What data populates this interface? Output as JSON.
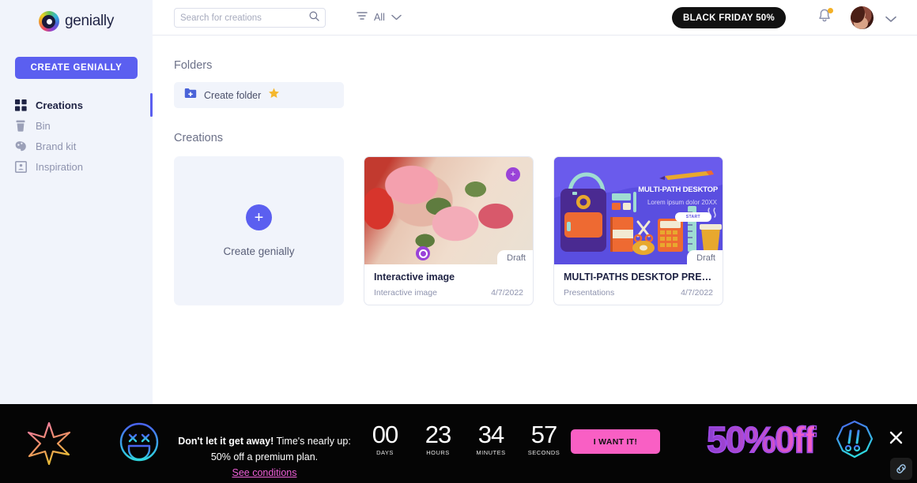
{
  "brand": {
    "name": "genially",
    "accent": "#5b5ff0"
  },
  "sidebar": {
    "create_button": "CREATE GENIALLY",
    "items": [
      {
        "label": "Creations",
        "icon": "grid-icon"
      },
      {
        "label": "Bin",
        "icon": "trash-icon"
      },
      {
        "label": "Brand kit",
        "icon": "paint-icon"
      },
      {
        "label": "Inspiration",
        "icon": "frame-icon"
      }
    ]
  },
  "topbar": {
    "search_placeholder": "Search for creations",
    "search_value": "",
    "filter_label": "All",
    "promo_button": "BLACK FRIDAY 50%"
  },
  "main": {
    "folders_heading": "Folders",
    "create_folder_label": "Create folder",
    "creations_heading": "Creations",
    "create_card_label": "Create genially",
    "cards": [
      {
        "title": "Interactive image",
        "type": "Interactive image",
        "date": "4/7/2022",
        "status": "Draft"
      },
      {
        "title": "MULTI-PATHS DESKTOP PRESENT…",
        "type": "Presentations",
        "date": "4/7/2022",
        "status": "Draft",
        "thumb_title": "MULTI-PATH DESKTOP",
        "thumb_subtitle": "Lorem ipsum dolor 20XX",
        "thumb_button": "START"
      }
    ]
  },
  "banner": {
    "headline_bold": "Don't let it get away!",
    "headline_rest": " Time's nearly up: 50% off a premium plan.",
    "link": "See conditions",
    "countdown": [
      {
        "value": "00",
        "label": "DAYS"
      },
      {
        "value": "23",
        "label": "HOURS"
      },
      {
        "value": "34",
        "label": "MINUTES"
      },
      {
        "value": "57",
        "label": "SECONDS"
      }
    ],
    "cta": "I WANT IT!",
    "offer": "50%0ff",
    "accent_pink": "#f95fc4",
    "link_color": "#ef5fd8"
  }
}
